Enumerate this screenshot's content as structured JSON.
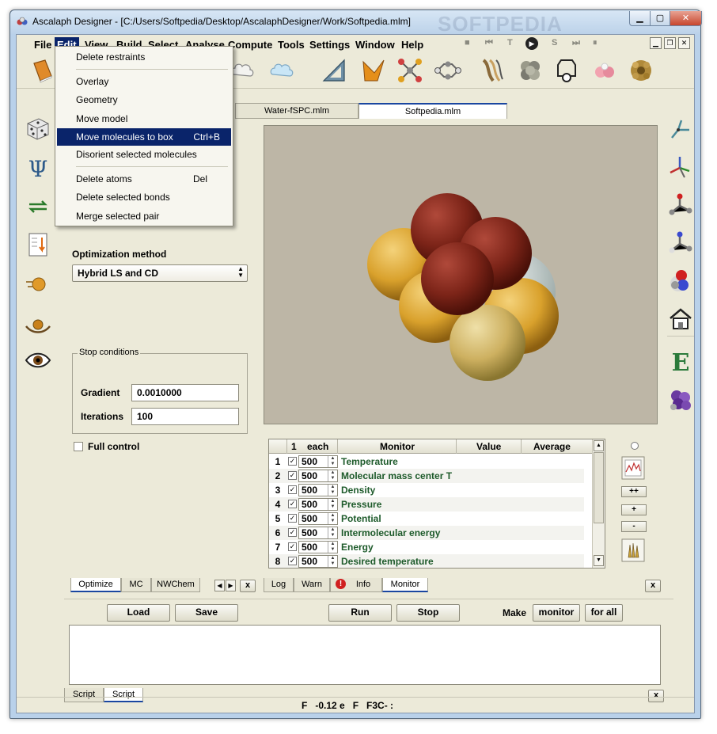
{
  "window": {
    "title": "Ascalaph Designer - [C:/Users/Softpedia/Desktop/AscalaphDesigner/Work/Softpedia.mlm]",
    "watermark": "SOFTPEDIA"
  },
  "menubar": {
    "items": [
      "File",
      "Edit",
      "View",
      "Build",
      "Select",
      "Analyse",
      "Compute",
      "Tools",
      "Settings",
      "Window",
      "Help"
    ],
    "active": "Edit",
    "player_controls": [
      "■",
      "⏮",
      "T",
      "▶",
      "S",
      "⏭",
      "⏸"
    ]
  },
  "edit_menu": {
    "items": [
      {
        "label": "Delete restraints",
        "shortcut": ""
      },
      {
        "label": "Overlay",
        "shortcut": ""
      },
      {
        "label": "Geometry",
        "shortcut": ""
      },
      {
        "label": "Move model",
        "shortcut": ""
      },
      {
        "label": "Move molecules to box",
        "shortcut": "Ctrl+B"
      },
      {
        "label": "Disorient selected molecules",
        "shortcut": ""
      },
      {
        "label": "Delete atoms",
        "shortcut": "Del"
      },
      {
        "label": "Delete selected bonds",
        "shortcut": ""
      },
      {
        "label": "Merge selected pair",
        "shortcut": ""
      }
    ],
    "highlighted_index": 4
  },
  "doc_tabs": [
    "Water-fSPC.mlm",
    "Softpedia.mlm"
  ],
  "optimize_panel": {
    "method_label": "Optimization method",
    "method_value": "Hybrid LS and CD",
    "stop_conditions_label": "Stop conditions",
    "gradient_label": "Gradient",
    "gradient_value": "0.0010000",
    "iterations_label": "Iterations",
    "iterations_value": "100",
    "full_control_label": "Full control",
    "tabs": [
      "Optimize",
      "MC",
      "NWChem"
    ],
    "close": "x"
  },
  "monitor": {
    "headers": {
      "first": "1",
      "each": "each",
      "monitor": "Monitor",
      "value": "Value",
      "average": "Average"
    },
    "rows": [
      {
        "num": "1",
        "each": "500",
        "name": "Temperature"
      },
      {
        "num": "2",
        "each": "500",
        "name": "Molecular mass center T"
      },
      {
        "num": "3",
        "each": "500",
        "name": "Density"
      },
      {
        "num": "4",
        "each": "500",
        "name": "Pressure"
      },
      {
        "num": "5",
        "each": "500",
        "name": "Potential"
      },
      {
        "num": "6",
        "each": "500",
        "name": "Intermolecular energy"
      },
      {
        "num": "7",
        "each": "500",
        "name": "Energy"
      },
      {
        "num": "8",
        "each": "500",
        "name": "Desired temperature"
      }
    ],
    "side_buttons": [
      "++",
      "+",
      "-"
    ],
    "tabs": [
      "Log",
      "Warn",
      "Info",
      "Monitor"
    ],
    "close": "x"
  },
  "script_panel": {
    "buttons": {
      "load": "Load",
      "save": "Save",
      "run": "Run",
      "stop": "Stop",
      "make": "Make",
      "monitor": "monitor",
      "for_all": "for all"
    },
    "tabs": [
      "Script",
      "Script"
    ],
    "close": "x"
  },
  "status": {
    "text": "F   -0.12 e   F   F3C- :"
  },
  "colors": {
    "menu_highlight": "#0a246a",
    "viewport_bg": "#bdb6a6",
    "monitor_text": "#1d5a2a"
  }
}
